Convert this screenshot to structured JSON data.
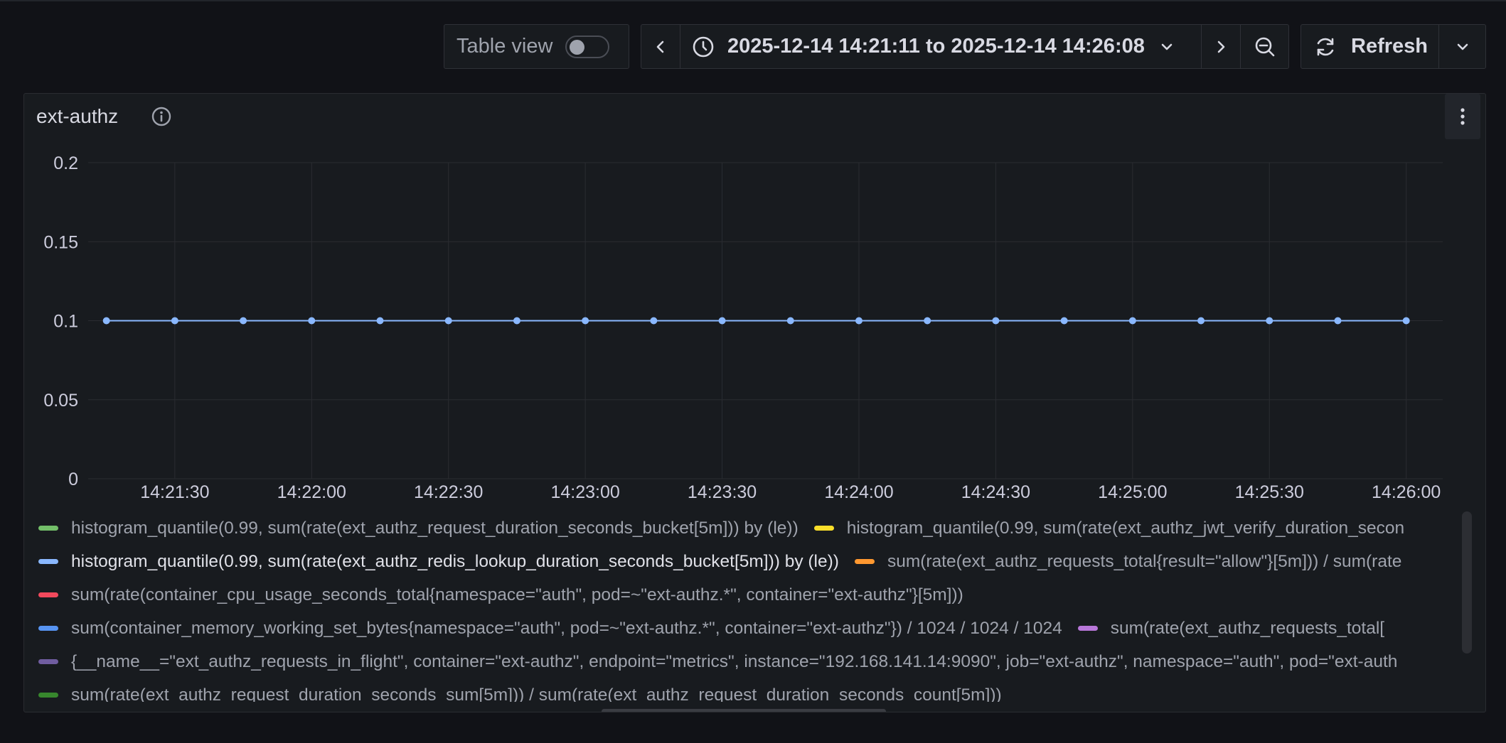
{
  "toolbar": {
    "table_view_label": "Table view",
    "table_view_enabled": false,
    "time_range": "2025-12-14 14:21:11 to 2025-12-14 14:26:08",
    "refresh_label": "Refresh"
  },
  "panel": {
    "title": "ext-authz"
  },
  "chart_data": {
    "type": "line",
    "title": "ext-authz",
    "xlabel": "",
    "ylabel": "",
    "ylim": [
      0,
      0.2
    ],
    "yticks": [
      "0",
      "0.05",
      "0.1",
      "0.15",
      "0.2"
    ],
    "xlim": [
      "14:21:11",
      "14:26:08"
    ],
    "xticks": [
      "14:21:30",
      "14:22:00",
      "14:22:30",
      "14:23:00",
      "14:23:30",
      "14:24:00",
      "14:24:30",
      "14:25:00",
      "14:25:30",
      "14:26:00"
    ],
    "grid": true,
    "legend_position": "bottom",
    "series": [
      {
        "name": "histogram_quantile(0.99, sum(rate(ext_authz_redis_lookup_duration_seconds_bucket[5m])) by (le))",
        "color": "#8ab8ff",
        "x": [
          "14:21:15",
          "14:21:30",
          "14:21:45",
          "14:22:00",
          "14:22:15",
          "14:22:30",
          "14:22:45",
          "14:23:00",
          "14:23:15",
          "14:23:30",
          "14:23:45",
          "14:24:00",
          "14:24:15",
          "14:24:30",
          "14:24:45",
          "14:25:00",
          "14:25:15",
          "14:25:30",
          "14:25:45",
          "14:26:00"
        ],
        "values": [
          0.1,
          0.1,
          0.1,
          0.1,
          0.1,
          0.1,
          0.1,
          0.1,
          0.1,
          0.1,
          0.1,
          0.1,
          0.1,
          0.1,
          0.1,
          0.1,
          0.1,
          0.1,
          0.1,
          0.1
        ]
      }
    ]
  },
  "legend": {
    "rows": [
      [
        {
          "label": "histogram_quantile(0.99, sum(rate(ext_authz_request_duration_seconds_bucket[5m])) by (le))",
          "color": "#73bf69",
          "active": false
        },
        {
          "label": "histogram_quantile(0.99, sum(rate(ext_authz_jwt_verify_duration_secon",
          "color": "#fade2a",
          "active": false
        }
      ],
      [
        {
          "label": "histogram_quantile(0.99, sum(rate(ext_authz_redis_lookup_duration_seconds_bucket[5m])) by (le))",
          "color": "#8ab8ff",
          "active": true
        },
        {
          "label": "sum(rate(ext_authz_requests_total{result=\"allow\"}[5m])) / sum(rate",
          "color": "#ff9830",
          "active": false
        }
      ],
      [
        {
          "label": "sum(rate(container_cpu_usage_seconds_total{namespace=\"auth\", pod=~\"ext-authz.*\", container=\"ext-authz\"}[5m]))",
          "color": "#f2495c",
          "active": false
        }
      ],
      [
        {
          "label": "sum(container_memory_working_set_bytes{namespace=\"auth\", pod=~\"ext-authz.*\", container=\"ext-authz\"}) / 1024 / 1024 / 1024",
          "color": "#5794f2",
          "active": false
        },
        {
          "label": "sum(rate(ext_authz_requests_total[",
          "color": "#b877d9",
          "active": false
        }
      ],
      [
        {
          "label": "{__name__=\"ext_authz_requests_in_flight\", container=\"ext-authz\", endpoint=\"metrics\", instance=\"192.168.141.14:9090\", job=\"ext-authz\", namespace=\"auth\", pod=\"ext-auth",
          "color": "#705da0",
          "active": false
        }
      ],
      [
        {
          "label": "sum(rate(ext_authz_request_duration_seconds_sum[5m])) / sum(rate(ext_authz_request_duration_seconds_count[5m]))",
          "color": "#37872d",
          "active": false
        }
      ]
    ]
  }
}
